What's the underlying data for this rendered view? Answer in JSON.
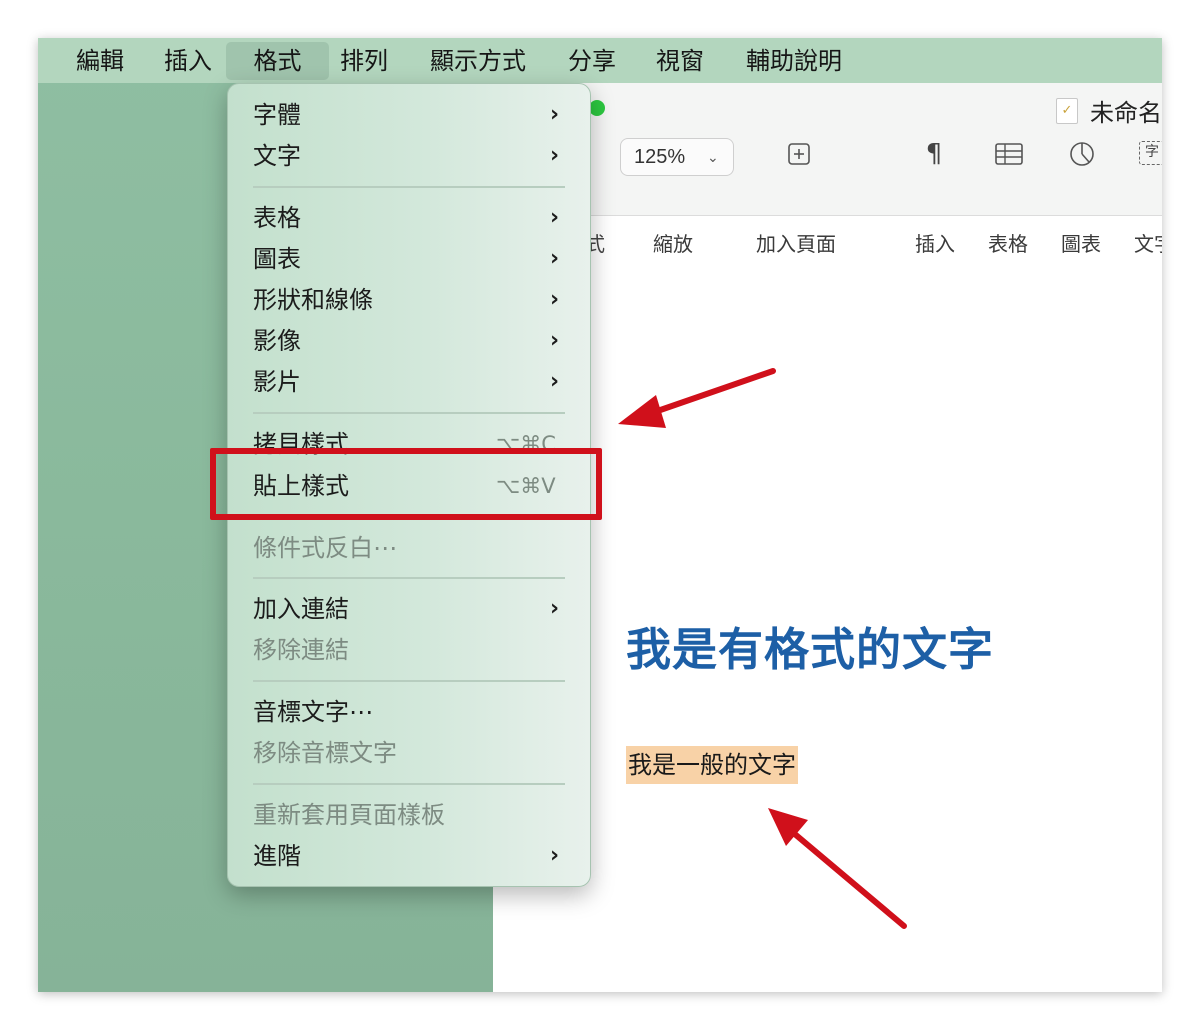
{
  "menubar": {
    "items": [
      {
        "label": "編輯",
        "active": false
      },
      {
        "label": "插入",
        "active": false
      },
      {
        "label": "格式",
        "active": true
      },
      {
        "label": "排列",
        "active": false
      },
      {
        "label": "顯示方式",
        "active": false
      },
      {
        "label": "分享",
        "active": false
      },
      {
        "label": "視窗",
        "active": false
      },
      {
        "label": "輔助說明",
        "active": false
      }
    ]
  },
  "window": {
    "title": "未命名",
    "toolbar": {
      "zoom_value": "125%",
      "cut_label": "式",
      "buttons": [
        {
          "label": "縮放",
          "icon": "zoom-select"
        },
        {
          "label": "加入頁面",
          "icon": "add-page-icon"
        },
        {
          "label": "插入",
          "icon": "paragraph-icon"
        },
        {
          "label": "表格",
          "icon": "table-icon"
        },
        {
          "label": "圖表",
          "icon": "chart-icon"
        },
        {
          "label": "文字",
          "icon": "text-box-icon",
          "icon_text": "字"
        }
      ]
    }
  },
  "document": {
    "heading": "我是有格式的文字",
    "normal_text": "我是一般的文字"
  },
  "format_menu": {
    "items": [
      {
        "label": "字體",
        "submenu": true,
        "disabled": false
      },
      {
        "label": "文字",
        "submenu": true,
        "disabled": false
      },
      {
        "label": "表格",
        "submenu": true,
        "disabled": false
      },
      {
        "label": "圖表",
        "submenu": true,
        "disabled": false
      },
      {
        "label": "形狀和線條",
        "submenu": true,
        "disabled": false
      },
      {
        "label": "影像",
        "submenu": true,
        "disabled": false
      },
      {
        "label": "影片",
        "submenu": true,
        "disabled": false
      },
      {
        "label": "拷貝樣式",
        "shortcut": "⌥⌘C",
        "disabled": false
      },
      {
        "label": "貼上樣式",
        "shortcut": "⌥⌘V",
        "disabled": false
      },
      {
        "label": "條件式反白⋯",
        "disabled": true
      },
      {
        "label": "加入連結",
        "submenu": true,
        "disabled": false
      },
      {
        "label": "移除連結",
        "disabled": true
      },
      {
        "label": "音標文字⋯",
        "disabled": false
      },
      {
        "label": "移除音標文字",
        "disabled": true
      },
      {
        "label": "重新套用頁面樣板",
        "disabled": true
      },
      {
        "label": "進階",
        "submenu": true,
        "disabled": false
      }
    ],
    "submenu_arrow": "›"
  },
  "colors": {
    "menubar_bg": "#b3d6be",
    "heading_blue": "#1d5fa6",
    "text_highlight": "#f8d2a7",
    "annotation_red": "#d0101b"
  }
}
